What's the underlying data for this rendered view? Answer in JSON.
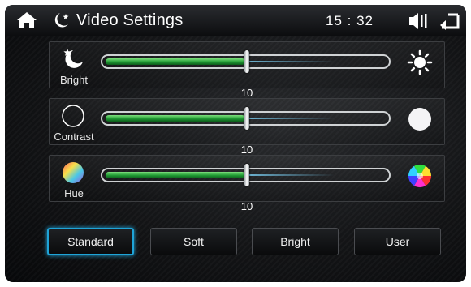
{
  "header": {
    "title": "Video Settings",
    "clock": "15 : 32",
    "icons": [
      "home-icon",
      "moon-icon",
      "volume-icon",
      "back-icon"
    ]
  },
  "sliders": [
    {
      "label": "Bright",
      "value": "10",
      "level": 0.5,
      "left_icon": "moon-star-icon",
      "right_icon": "sun-icon"
    },
    {
      "label": "Contrast",
      "value": "10",
      "level": 0.5,
      "left_icon": "dark-circle-icon",
      "right_icon": "light-circle-icon"
    },
    {
      "label": "Hue",
      "value": "10",
      "level": 0.5,
      "left_icon": "color-wheel-icon",
      "right_icon": "color-wheel-icon"
    }
  ],
  "presets": [
    {
      "label": "Standard",
      "selected": true
    },
    {
      "label": "Soft",
      "selected": false
    },
    {
      "label": "Bright",
      "selected": false
    },
    {
      "label": "User",
      "selected": false
    }
  ],
  "colors": {
    "accent": "#1fa4d8",
    "slider_fill": "#1f9a33"
  }
}
